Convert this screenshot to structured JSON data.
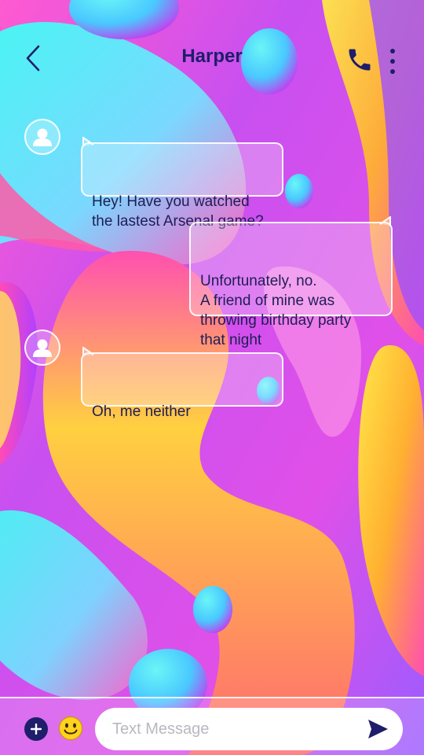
{
  "header": {
    "title": "Harper",
    "back_icon": "chevron-left-icon",
    "call_icon": "phone-icon",
    "more_icon": "more-vertical-icon"
  },
  "messages": [
    {
      "direction": "incoming",
      "text": "Hey! Have you watched\nthe lastest Arsenal game?",
      "has_avatar": true
    },
    {
      "direction": "outgoing",
      "text": "Unfortunately, no.\nA friend of mine was\nthrowing birthday party\nthat night",
      "has_avatar": false
    },
    {
      "direction": "incoming",
      "text": "Oh, me neither",
      "has_avatar": true
    }
  ],
  "composer": {
    "placeholder": "Text Message",
    "add_icon": "plus-icon",
    "emoji_icon": "emoji-smile-icon",
    "send_icon": "send-icon"
  },
  "colors": {
    "accent": "#1e1e6a",
    "bubble_border": "#ffffff",
    "wallpaper_pink": "#f040d8",
    "wallpaper_cyan": "#40f0f0",
    "wallpaper_yellow": "#ffe040",
    "wallpaper_purple": "#9a50ff"
  }
}
